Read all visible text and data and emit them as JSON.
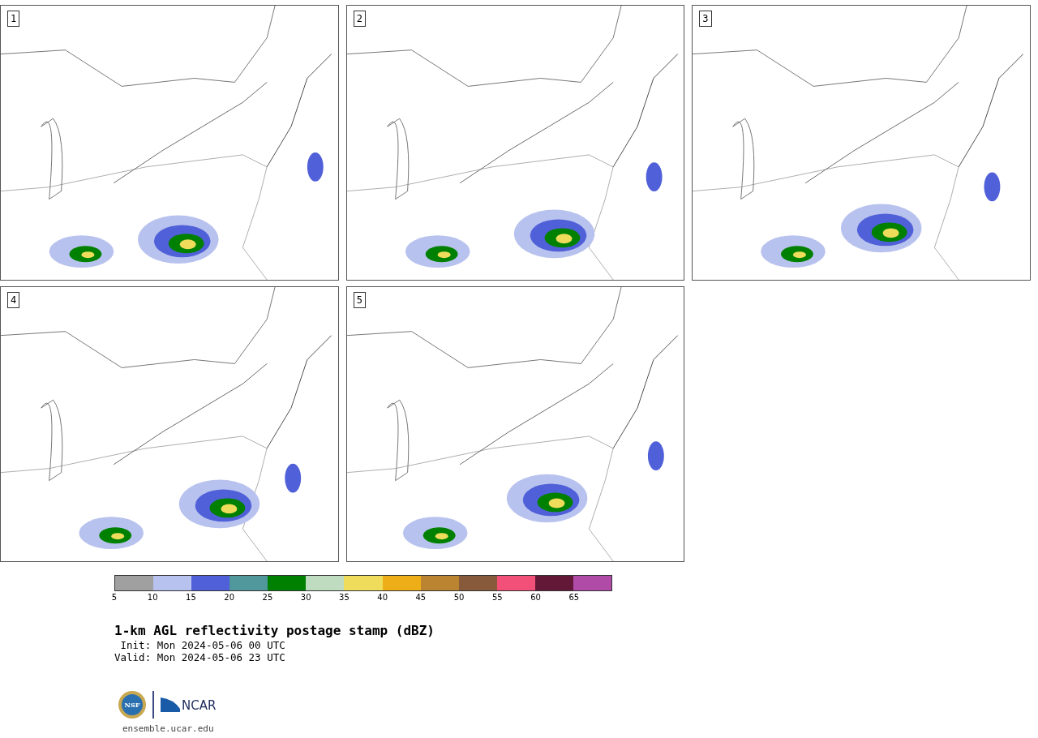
{
  "panels": [
    {
      "label": "1"
    },
    {
      "label": "2"
    },
    {
      "label": "3"
    },
    {
      "label": "4"
    },
    {
      "label": "5"
    }
  ],
  "colorbar": [
    {
      "label": "5",
      "color": "#a0a0a0"
    },
    {
      "label": "10",
      "color": "#b8c2ee"
    },
    {
      "label": "15",
      "color": "#5060d8"
    },
    {
      "label": "20",
      "color": "#50989c"
    },
    {
      "label": "25",
      "color": "#008000"
    },
    {
      "label": "30",
      "color": "#c0dcc0"
    },
    {
      "label": "35",
      "color": "#eedc5a"
    },
    {
      "label": "40",
      "color": "#eeae18"
    },
    {
      "label": "45",
      "color": "#bb8430"
    },
    {
      "label": "50",
      "color": "#885a3c"
    },
    {
      "label": "55",
      "color": "#f25078"
    },
    {
      "label": "60",
      "color": "#641838"
    },
    {
      "label": "65",
      "color": "#b04ca8"
    }
  ],
  "title": "1-km AGL reflectivity postage stamp (dBZ)",
  "init": " Init: Mon 2024-05-06 00 UTC",
  "valid": "Valid: Mon 2024-05-06 23 UTC",
  "logos": {
    "nsf": "NSF",
    "ncar": "NCAR"
  },
  "url": "ensemble.ucar.edu"
}
